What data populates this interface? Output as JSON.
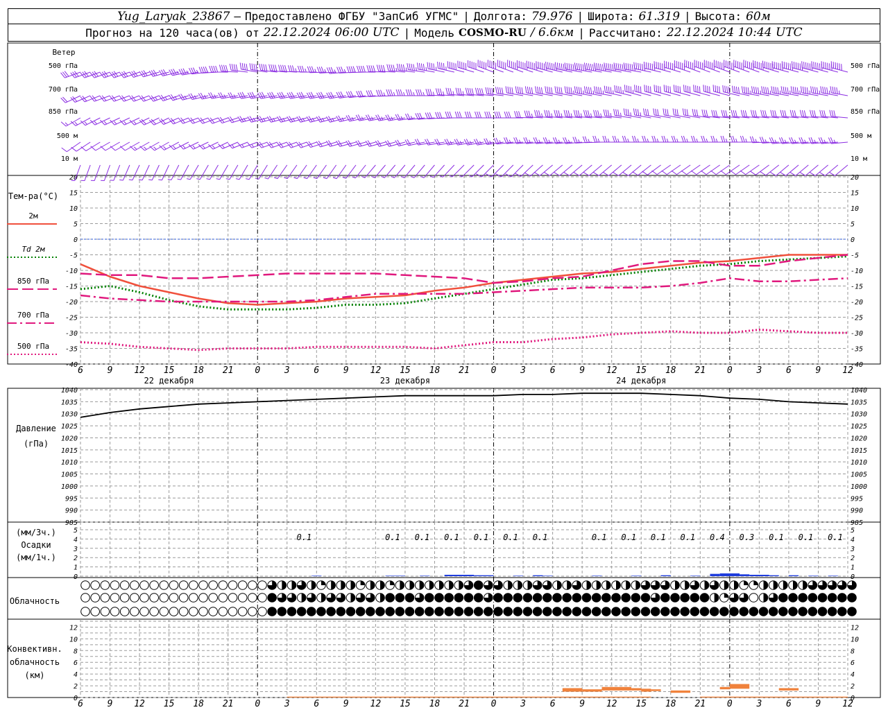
{
  "header": {
    "station": "Yug_Laryak_23867",
    "provided_by": "Предоставлено ФГБУ \"ЗапСиб УГМС\"",
    "lon_label": "Долгота:",
    "lon_value": "79.976",
    "lat_label": "Широта:",
    "lat_value": "61.319",
    "alt_label": "Высота:",
    "alt_value": "60м",
    "forecast_prefix": "Прогноз на 120 часа(ов) от",
    "forecast_start": "22.12.2024 06:00 UTC",
    "model_label": "Модель",
    "model_name": "COSMO-RU",
    "model_res": "/ 6.6км",
    "calc_label": "Рассчитано:",
    "calc_time": "22.12.2024 10:44 UTC"
  },
  "chart_data": [
    {
      "type": "line",
      "panel": "wind",
      "title": "Ветер",
      "levels": [
        "500 гПа",
        "700 гПа",
        "850 гПа",
        "500 м",
        "10  м"
      ],
      "color": "#8a2be2",
      "x_hours": [
        6,
        9,
        12,
        15,
        18,
        21,
        24,
        27,
        30,
        33,
        36,
        39,
        42,
        45,
        48,
        51,
        54,
        57,
        60,
        63,
        66,
        69,
        72,
        75,
        78,
        81,
        84
      ],
      "direction_deg": {
        "500 гПа": [
          250,
          250,
          250,
          255,
          260,
          270,
          280,
          275,
          270,
          265,
          270,
          275,
          280,
          285,
          290,
          290,
          285,
          280,
          280,
          280,
          285,
          290,
          290,
          290,
          285,
          285,
          285
        ],
        "700 гПа": [
          245,
          250,
          250,
          250,
          255,
          260,
          260,
          260,
          260,
          260,
          265,
          270,
          270,
          275,
          275,
          280,
          280,
          280,
          280,
          285,
          285,
          285,
          285,
          280,
          280,
          280,
          280
        ],
        "850 гПа": [
          240,
          245,
          245,
          245,
          250,
          250,
          255,
          255,
          255,
          255,
          260,
          260,
          265,
          270,
          270,
          270,
          275,
          275,
          275,
          280,
          280,
          280,
          275,
          275,
          275,
          275,
          275
        ],
        "500 м": [
          235,
          240,
          240,
          240,
          245,
          245,
          250,
          250,
          250,
          255,
          255,
          255,
          260,
          260,
          260,
          265,
          265,
          265,
          270,
          270,
          270,
          270,
          270,
          270,
          265,
          265,
          265
        ],
        "10  м": [
          200,
          200,
          205,
          205,
          210,
          210,
          210,
          215,
          215,
          215,
          220,
          220,
          220,
          225,
          225,
          225,
          230,
          230,
          230,
          230,
          235,
          235,
          235,
          235,
          230,
          230,
          230
        ]
      },
      "speed_ms": {
        "500 гПа": [
          15,
          15,
          15,
          15,
          18,
          20,
          20,
          20,
          18,
          18,
          20,
          22,
          22,
          25,
          25,
          28,
          28,
          30,
          30,
          30,
          30,
          32,
          32,
          30,
          30,
          30,
          30
        ],
        "700 гПа": [
          10,
          10,
          10,
          12,
          12,
          12,
          15,
          15,
          15,
          15,
          15,
          18,
          18,
          18,
          20,
          20,
          20,
          22,
          22,
          22,
          20,
          20,
          20,
          22,
          22,
          22,
          22
        ],
        "850 гПа": [
          8,
          8,
          8,
          10,
          10,
          10,
          12,
          12,
          12,
          12,
          12,
          12,
          15,
          15,
          15,
          15,
          18,
          18,
          18,
          18,
          15,
          15,
          15,
          15,
          15,
          15,
          15
        ],
        "500 м": [
          6,
          6,
          6,
          8,
          8,
          8,
          8,
          10,
          10,
          10,
          10,
          10,
          10,
          12,
          12,
          12,
          12,
          12,
          12,
          12,
          12,
          12,
          12,
          12,
          12,
          12,
          12
        ],
        "10  м": [
          2,
          2,
          2,
          2,
          3,
          3,
          3,
          3,
          3,
          3,
          3,
          3,
          3,
          3,
          4,
          4,
          4,
          4,
          4,
          4,
          4,
          4,
          4,
          4,
          4,
          4,
          4
        ]
      }
    },
    {
      "type": "line",
      "panel": "temperature",
      "title": "Тем-ра(°С)",
      "ylim": [
        -40,
        20
      ],
      "y_ticks": [
        20,
        15,
        10,
        5,
        0,
        -5,
        -10,
        -15,
        -20,
        -25,
        -30,
        -35,
        -40
      ],
      "x_hours": [
        6,
        9,
        12,
        15,
        18,
        21,
        24,
        27,
        30,
        33,
        36,
        39,
        42,
        45,
        48,
        51,
        54,
        57,
        60,
        63,
        66,
        69,
        72,
        75,
        78,
        81,
        84
      ],
      "series": [
        {
          "name": "2м",
          "color": "#f0503c",
          "dash": "solid",
          "values": [
            -8,
            -12,
            -15,
            -17,
            -19,
            -20.5,
            -21,
            -20.5,
            -20,
            -19,
            -18.5,
            -18,
            -16.5,
            -15.5,
            -14,
            -13,
            -12,
            -11,
            -10.5,
            -9.5,
            -8.5,
            -7.5,
            -7,
            -6,
            -5,
            -5,
            -5
          ]
        },
        {
          "name": "Td  2м",
          "color": "#008000",
          "dash": "dot",
          "values": [
            -16,
            -15,
            -17,
            -19.5,
            -21.5,
            -22.5,
            -22.5,
            -22.5,
            -22,
            -21,
            -21,
            -20.5,
            -19,
            -17.5,
            -16,
            -14.5,
            -13,
            -12.5,
            -11.5,
            -10.5,
            -9.5,
            -8.5,
            -8,
            -7,
            -6.5,
            -6,
            -5.5
          ]
        },
        {
          "name": "850 гПа",
          "color": "#e0187d",
          "dash": "longdash",
          "values": [
            -11,
            -11.5,
            -11.5,
            -12.5,
            -12.5,
            -12,
            -11.5,
            -11,
            -11,
            -11,
            -11,
            -11.5,
            -12,
            -12.5,
            -14,
            -13.5,
            -12.5,
            -12,
            -10,
            -8,
            -7,
            -7,
            -8.5,
            -8.5,
            -7,
            -6,
            -5
          ]
        },
        {
          "name": "700 гПа",
          "color": "#e0187d",
          "dash": "dashdot",
          "values": [
            -18,
            -19,
            -19.5,
            -20,
            -20,
            -20,
            -20,
            -20,
            -19.5,
            -18.5,
            -17.5,
            -17.5,
            -17.5,
            -17.5,
            -17,
            -16.5,
            -16,
            -15.5,
            -15.5,
            -15.5,
            -15,
            -14,
            -12.5,
            -13.5,
            -13.5,
            -13,
            -12.5
          ]
        },
        {
          "name": "500 гПа",
          "color": "#e0187d",
          "dash": "dot",
          "values": [
            -33,
            -33.5,
            -34.5,
            -35,
            -35.5,
            -35,
            -35,
            -35,
            -34.5,
            -34.5,
            -34.5,
            -34.5,
            -35,
            -34,
            -33,
            -33,
            -32,
            -31.5,
            -30.5,
            -30,
            -29.5,
            -30,
            -30,
            -29,
            -29.5,
            -30,
            -30
          ]
        }
      ]
    },
    {
      "type": "line",
      "panel": "pressure",
      "title": "Давление",
      "ylabel": "(гПа)",
      "ylim": [
        985,
        1040
      ],
      "y_ticks": [
        1040,
        1035,
        1030,
        1025,
        1020,
        1015,
        1010,
        1005,
        1000,
        995,
        990,
        985
      ],
      "x_hours": [
        6,
        9,
        12,
        15,
        18,
        21,
        24,
        27,
        30,
        33,
        36,
        39,
        42,
        45,
        48,
        51,
        54,
        57,
        60,
        63,
        66,
        69,
        72,
        75,
        78,
        81,
        84
      ],
      "series": [
        {
          "color": "#000000",
          "values": [
            1028.5,
            1030.5,
            1032,
            1033,
            1034,
            1034.5,
            1035,
            1035.5,
            1036,
            1036.5,
            1037,
            1037.5,
            1037.5,
            1037.5,
            1037.5,
            1038,
            1038,
            1038.5,
            1038.5,
            1038.5,
            1038,
            1037.5,
            1036.5,
            1036,
            1035,
            1034.5,
            1034
          ]
        }
      ]
    },
    {
      "type": "bar",
      "panel": "precipitation",
      "title": "Осадки",
      "ylabel_top": "(мм/3ч.)",
      "ylabel_bottom": "(мм/1ч.)",
      "ylim": [
        0,
        5
      ],
      "y_ticks": [
        5,
        4,
        3,
        2,
        1,
        0
      ],
      "color": "#1e3cdc",
      "labels": [
        {
          "hour": 30,
          "text": "0.1"
        },
        {
          "hour": 39,
          "text": "0.1"
        },
        {
          "hour": 42,
          "text": "0.1"
        },
        {
          "hour": 45,
          "text": "0.1"
        },
        {
          "hour": 48,
          "text": "0.1"
        },
        {
          "hour": 51,
          "text": "0.1"
        },
        {
          "hour": 54,
          "text": "0.1"
        },
        {
          "hour": 60,
          "text": "0.1"
        },
        {
          "hour": 63,
          "text": "0.1"
        },
        {
          "hour": 66,
          "text": "0.1"
        },
        {
          "hour": 69,
          "text": "0.1"
        },
        {
          "hour": 72,
          "text": "0.4"
        },
        {
          "hour": 75,
          "text": "0.3"
        },
        {
          "hour": 78,
          "text": "0.1"
        },
        {
          "hour": 81,
          "text": "0.1"
        },
        {
          "hour": 84,
          "text": "0.1"
        }
      ],
      "bars": [
        {
          "start": 29.5,
          "end": 30.5,
          "value": 0.05
        },
        {
          "start": 37,
          "end": 38,
          "value": 0.05
        },
        {
          "start": 38,
          "end": 39,
          "value": 0.05
        },
        {
          "start": 40.5,
          "end": 41.5,
          "value": 0.05
        },
        {
          "start": 43,
          "end": 46,
          "value": 0.15
        },
        {
          "start": 46,
          "end": 48,
          "value": 0.1
        },
        {
          "start": 50,
          "end": 51,
          "value": 0.05
        },
        {
          "start": 52,
          "end": 53,
          "value": 0.1
        },
        {
          "start": 53,
          "end": 54,
          "value": 0.05
        },
        {
          "start": 58,
          "end": 59,
          "value": 0.05
        },
        {
          "start": 62,
          "end": 63,
          "value": 0.05
        },
        {
          "start": 65,
          "end": 66,
          "value": 0.1
        },
        {
          "start": 68,
          "end": 69,
          "value": 0.05
        },
        {
          "start": 70,
          "end": 71,
          "value": 0.25
        },
        {
          "start": 71,
          "end": 73,
          "value": 0.3
        },
        {
          "start": 73,
          "end": 74,
          "value": 0.2
        },
        {
          "start": 74,
          "end": 76,
          "value": 0.15
        },
        {
          "start": 76,
          "end": 77,
          "value": 0.1
        },
        {
          "start": 78,
          "end": 79,
          "value": 0.1
        },
        {
          "start": 80,
          "end": 81,
          "value": 0.05
        },
        {
          "start": 82,
          "end": 83,
          "value": 0.05
        }
      ]
    },
    {
      "type": "table",
      "panel": "cloudiness",
      "title": "Облачность",
      "note": "cloud cover fraction per hour, rows top to bottom, 79 hourly points from 6 to 84",
      "rows": [
        [
          0,
          0,
          0,
          0,
          0,
          0,
          0,
          0,
          0,
          0,
          0,
          0,
          0,
          0,
          0,
          0,
          0,
          0,
          0,
          0.75,
          0.5,
          0.5,
          0.75,
          0.5,
          0.25,
          0.5,
          0.5,
          0.5,
          0.25,
          0.5,
          0.5,
          0.25,
          0.5,
          0.5,
          0.5,
          0.5,
          0.5,
          0.5,
          0.5,
          0.75,
          1,
          0.75,
          0.75,
          0.5,
          0.5,
          0.5,
          0.75,
          0.75,
          0.5,
          0.5,
          0.75,
          0.5,
          0.5,
          0.5,
          0.5,
          0.5,
          0.5,
          0.75,
          0.75,
          0.75,
          0.5,
          0.5,
          0.75,
          0.5,
          0.75,
          0.5,
          0.5,
          0.25,
          0.25,
          0.5,
          0.5,
          0.5,
          0.5,
          0.5,
          0.75,
          0.75,
          0.75,
          0.75,
          0.75
        ],
        [
          0,
          0,
          0,
          0,
          0,
          0,
          0,
          0,
          0,
          0,
          0,
          0,
          0,
          0,
          0,
          0,
          0,
          0,
          0,
          1,
          0.75,
          0.75,
          0.5,
          0.75,
          0.5,
          0.75,
          0.75,
          0.5,
          0.75,
          0.75,
          0.5,
          1,
          1,
          1,
          0.75,
          1,
          1,
          1,
          1,
          1,
          1,
          0.75,
          1,
          1,
          1,
          1,
          1,
          1,
          1,
          1,
          1,
          1,
          1,
          1,
          1,
          1,
          1,
          1,
          0.75,
          1,
          1,
          1,
          1,
          1,
          0.5,
          0.25,
          0.75,
          0.75,
          0,
          0.5,
          0.75,
          1,
          1,
          1,
          1,
          1,
          1,
          1,
          1
        ],
        [
          0,
          0,
          0,
          0,
          0,
          0,
          0,
          0,
          0,
          0,
          0,
          0,
          0,
          0,
          0,
          0,
          0,
          0,
          0,
          1,
          1,
          1,
          1,
          1,
          1,
          1,
          1,
          1,
          1,
          1,
          1,
          1,
          1,
          1,
          1,
          1,
          1,
          1,
          1,
          1,
          1,
          1,
          1,
          1,
          1,
          1,
          1,
          1,
          1,
          1,
          1,
          1,
          1,
          1,
          1,
          1,
          1,
          1,
          1,
          1,
          1,
          1,
          1,
          1,
          1,
          1,
          1,
          1,
          1,
          1,
          1,
          1,
          1,
          1,
          1,
          1,
          1,
          1,
          1
        ]
      ]
    },
    {
      "type": "bar",
      "panel": "convective",
      "title_lines": [
        "Конвективн.",
        "облачность",
        "(км)"
      ],
      "ylim": [
        0,
        13
      ],
      "y_ticks": [
        12,
        10,
        8,
        6,
        4,
        2,
        0
      ],
      "color": "#f0823c",
      "bars": [
        {
          "start": 27,
          "end": 64,
          "base": 0,
          "top": 0.15
        },
        {
          "start": 55,
          "end": 57,
          "base": 1,
          "top": 1.6
        },
        {
          "start": 57,
          "end": 59,
          "base": 1,
          "top": 1.4
        },
        {
          "start": 59,
          "end": 62,
          "base": 1.2,
          "top": 1.8
        },
        {
          "start": 62,
          "end": 63,
          "base": 1.2,
          "top": 1.6
        },
        {
          "start": 63,
          "end": 64,
          "base": 1,
          "top": 1.5
        },
        {
          "start": 64,
          "end": 65,
          "base": 1.1,
          "top": 1.4
        },
        {
          "start": 66,
          "end": 68,
          "base": 0.8,
          "top": 1.2
        },
        {
          "start": 71,
          "end": 72,
          "base": 1.4,
          "top": 1.8
        },
        {
          "start": 72,
          "end": 74,
          "base": 1.5,
          "top": 2.3
        },
        {
          "start": 77,
          "end": 79,
          "base": 1.2,
          "top": 1.6
        },
        {
          "start": 69,
          "end": 84,
          "base": 0,
          "top": 0.15
        }
      ]
    }
  ],
  "x_axis": {
    "hour_labels": [
      "6",
      "9",
      "12",
      "15",
      "18",
      "21",
      "0",
      "3",
      "6",
      "9",
      "12",
      "15",
      "18",
      "21",
      "0",
      "3",
      "6",
      "9",
      "12",
      "15",
      "18",
      "21",
      "0",
      "3",
      "6",
      "9",
      "12"
    ],
    "day_labels": [
      {
        "hour": 15,
        "text": "22 декабря"
      },
      {
        "hour": 39,
        "text": "23 декабря"
      },
      {
        "hour": 63,
        "text": "24 декабря"
      }
    ]
  }
}
